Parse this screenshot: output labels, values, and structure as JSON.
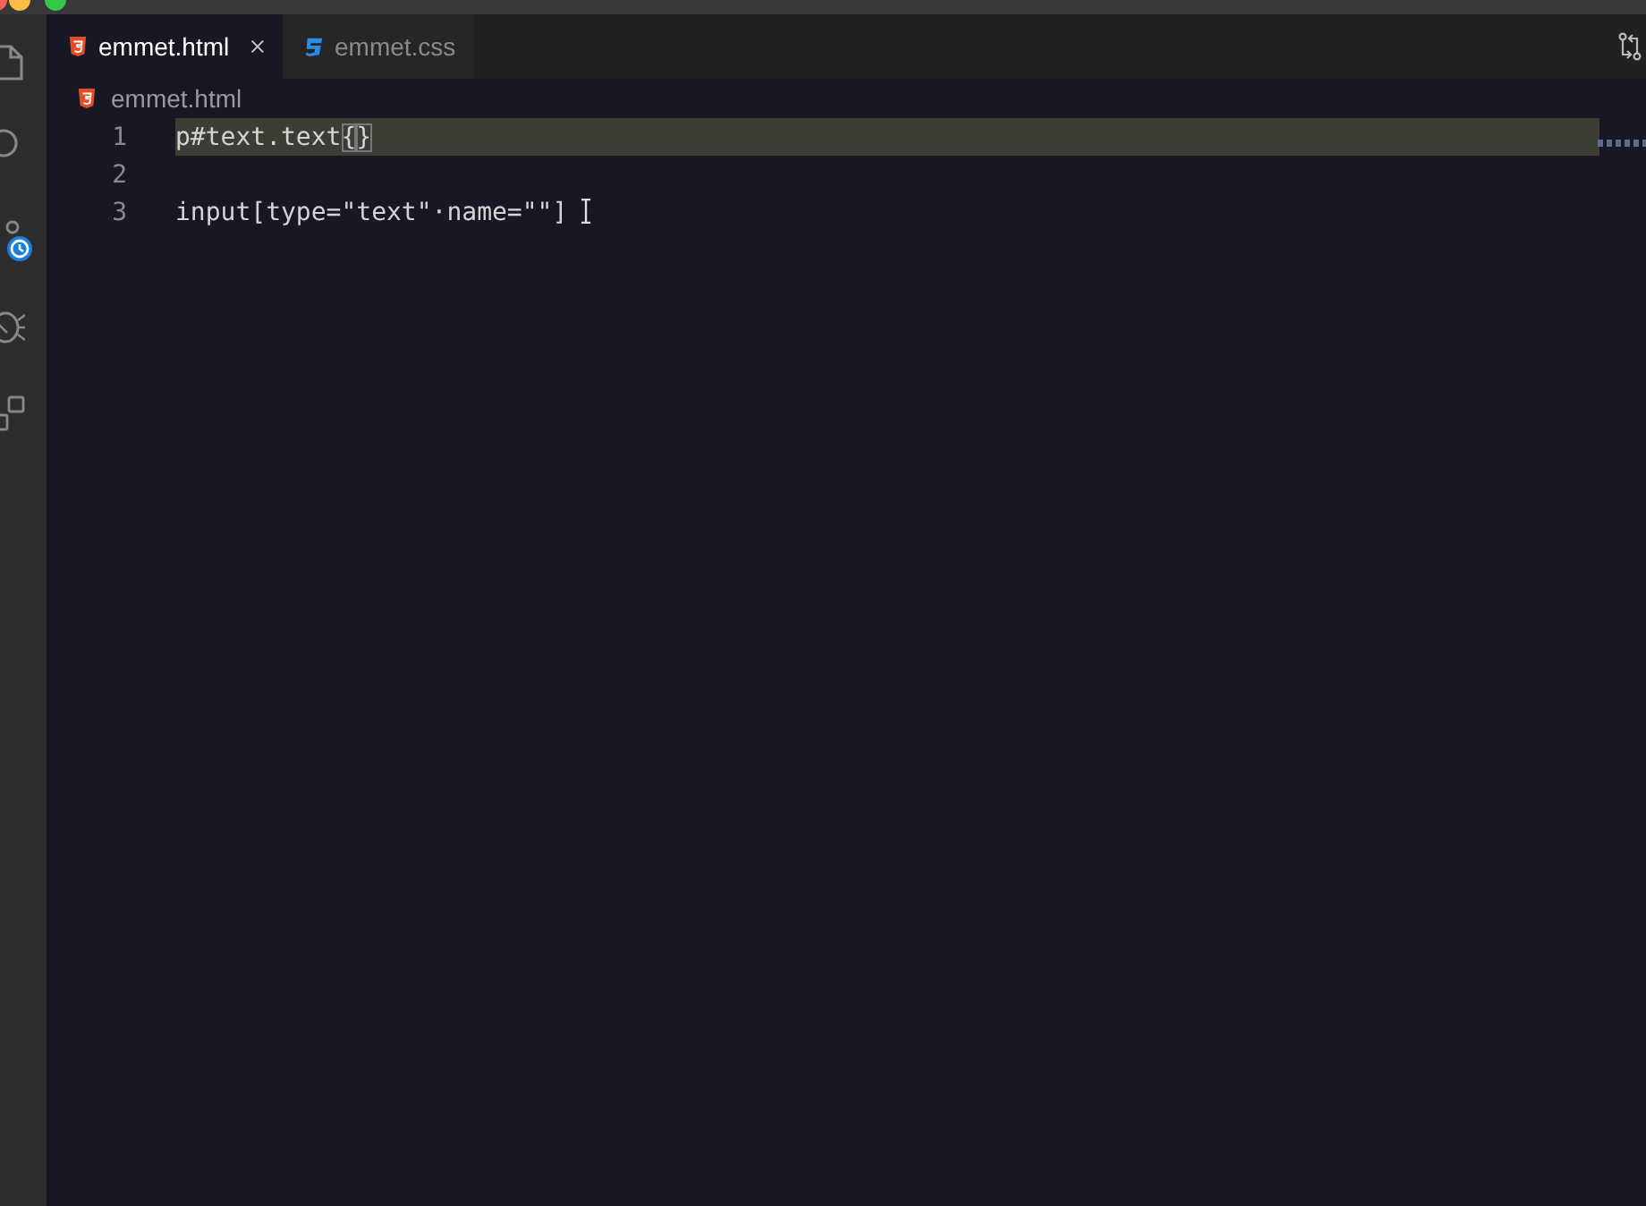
{
  "tabs": [
    {
      "label": "emmet.html",
      "kind": "html",
      "selected": true
    },
    {
      "label": "emmet.css",
      "kind": "css",
      "selected": false
    }
  ],
  "breadcrumb": {
    "label": "emmet.html",
    "kind": "html"
  },
  "lines": [
    {
      "number": "1",
      "code": "p#text.text",
      "brackets": [
        "{",
        "}"
      ],
      "current": true
    },
    {
      "number": "2",
      "current": false
    },
    {
      "number": "3",
      "code": "input[type=\"text\"·name=\"\"]",
      "current": false
    }
  ]
}
